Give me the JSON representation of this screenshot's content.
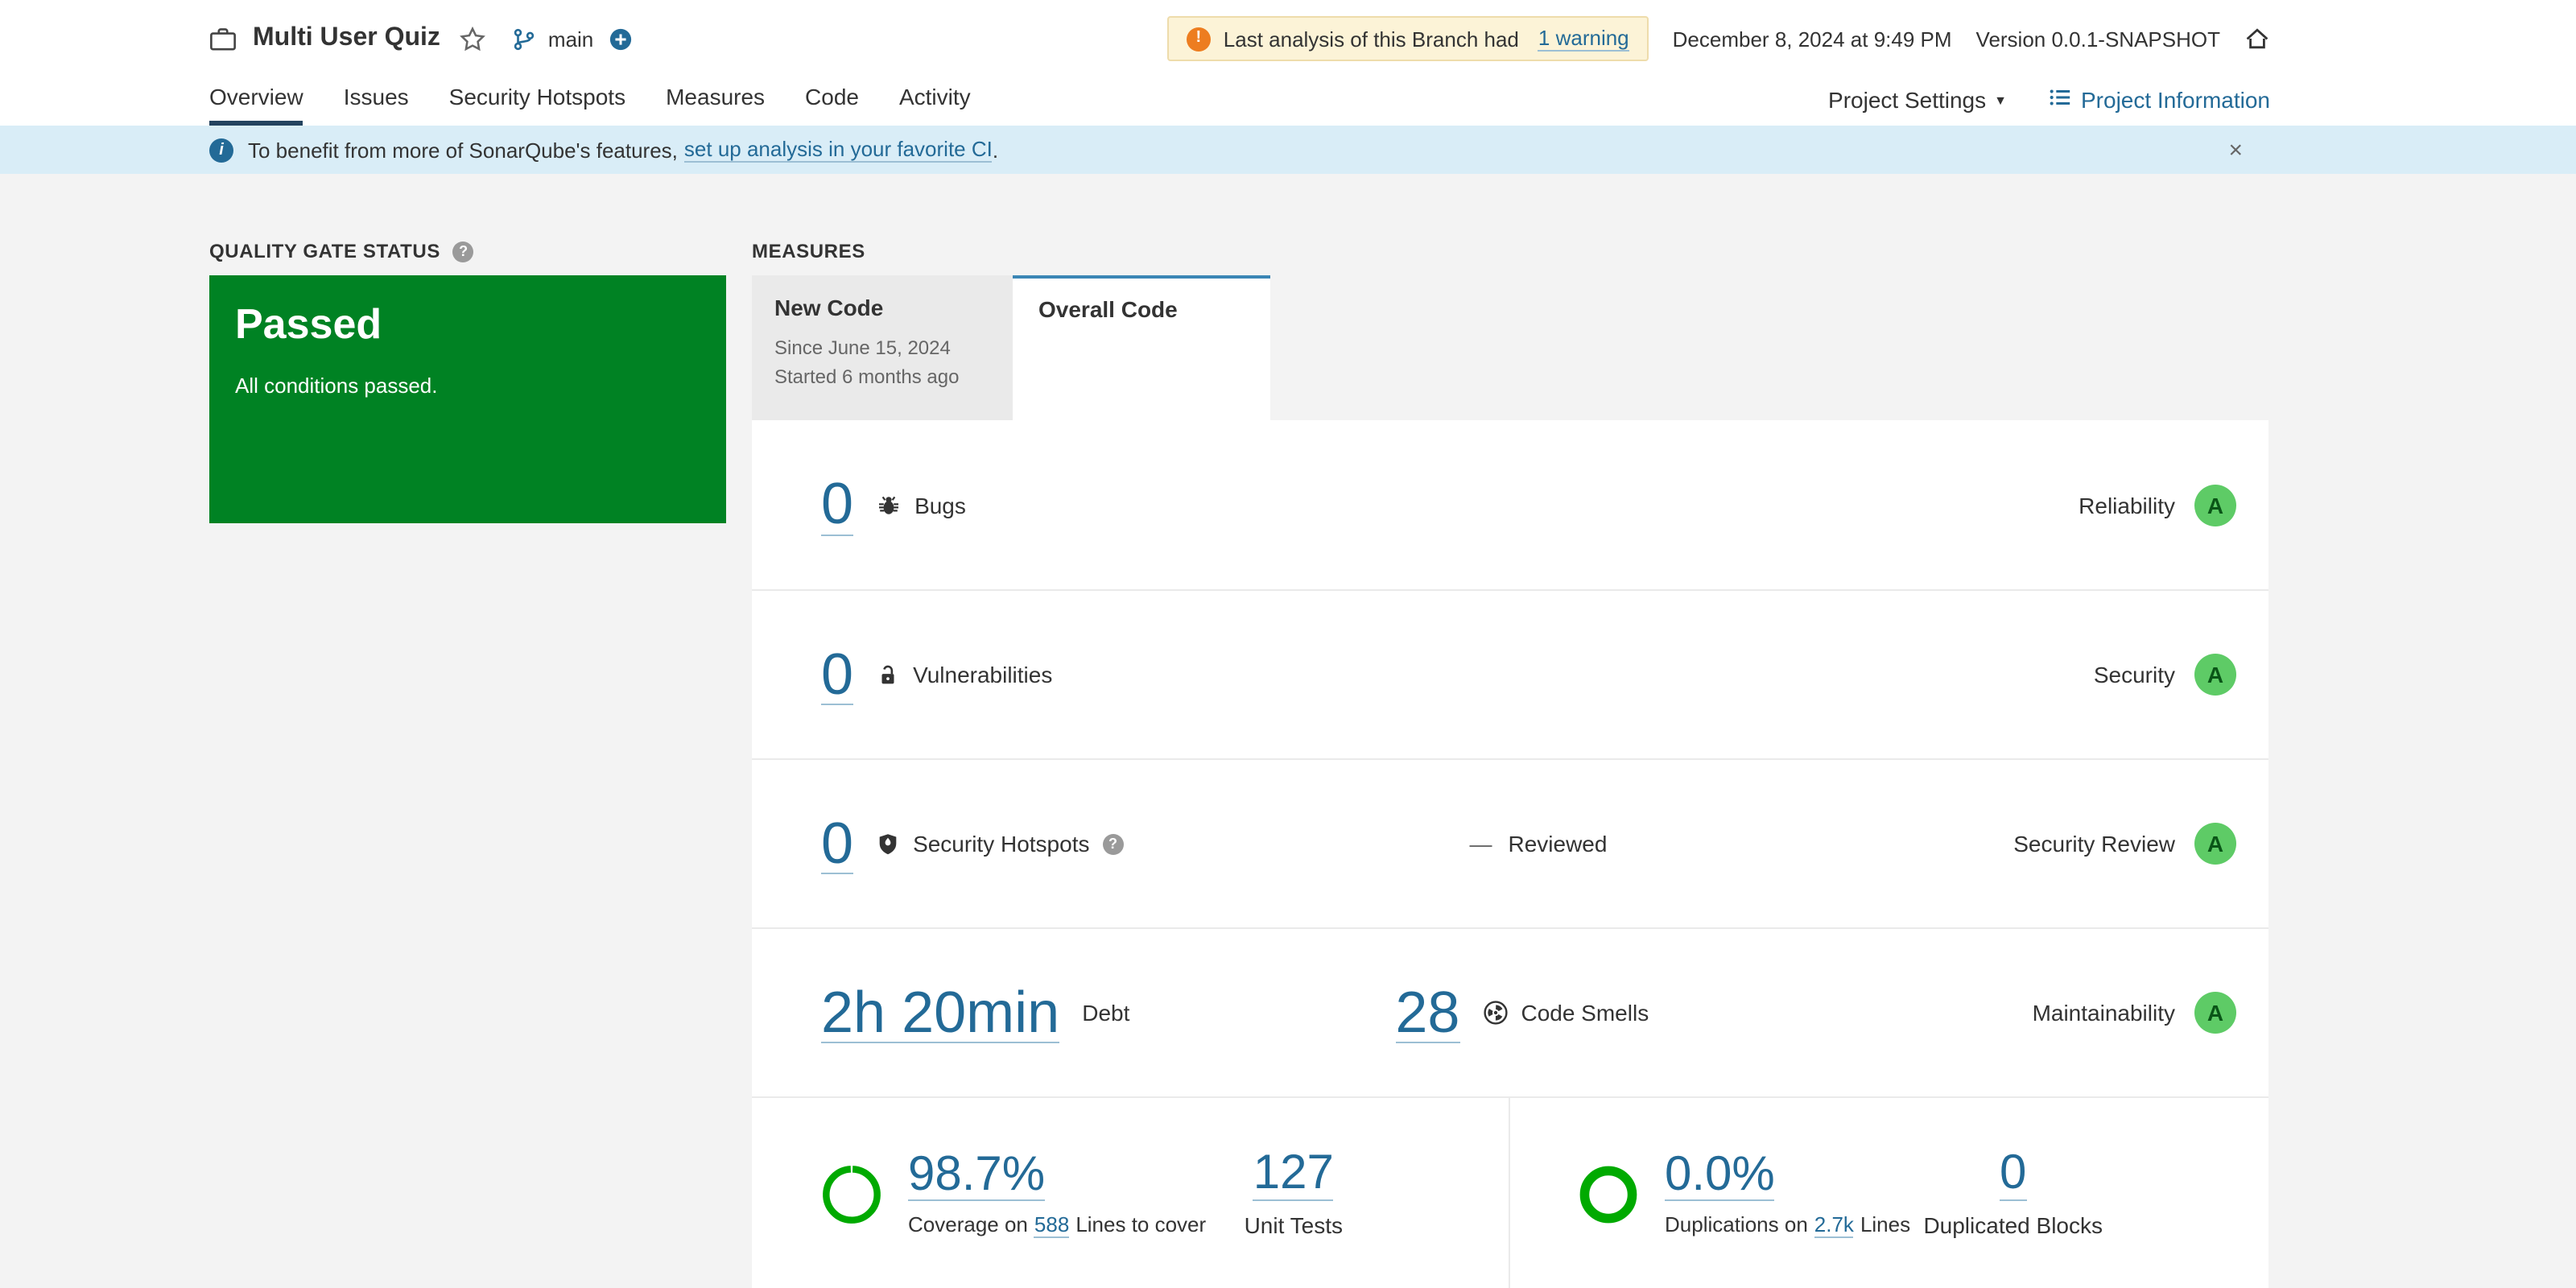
{
  "header": {
    "project_name": "Multi User Quiz",
    "branch": "main",
    "warning_text": "Last analysis of this Branch had",
    "warning_link": "1 warning",
    "analysis_date": "December 8, 2024 at 9:49 PM",
    "version_label": "Version 0.0.1-SNAPSHOT"
  },
  "nav": {
    "tabs": [
      {
        "label": "Overview",
        "active": true
      },
      {
        "label": "Issues",
        "active": false
      },
      {
        "label": "Security Hotspots",
        "active": false
      },
      {
        "label": "Measures",
        "active": false
      },
      {
        "label": "Code",
        "active": false
      },
      {
        "label": "Activity",
        "active": false
      }
    ],
    "project_settings_label": "Project Settings",
    "project_information_label": "Project Information"
  },
  "banner": {
    "message_prefix": "To benefit from more of SonarQube's features,",
    "link_text": "set up analysis in your favorite CI",
    "message_suffix": "."
  },
  "icons": {
    "warning_mark": "!",
    "info_mark": "i",
    "help_mark": "?",
    "close_mark": "×",
    "caret_down": "▼"
  },
  "quality_gate": {
    "heading": "QUALITY GATE STATUS",
    "status": "Passed",
    "detail": "All conditions passed."
  },
  "measures": {
    "heading": "MEASURES",
    "new_code_tab": {
      "label": "New Code",
      "since": "Since June 15, 2024",
      "started": "Started 6 months ago"
    },
    "overall_code_tab": {
      "label": "Overall Code"
    },
    "rows": {
      "bugs": {
        "value": "0",
        "label": "Bugs",
        "domain": "Reliability",
        "rating": "A"
      },
      "vulnerabilities": {
        "value": "0",
        "label": "Vulnerabilities",
        "domain": "Security",
        "rating": "A"
      },
      "hotspots": {
        "value": "0",
        "label": "Security Hotspots",
        "reviewed_value": "—",
        "reviewed_label": "Reviewed",
        "domain": "Security Review",
        "rating": "A"
      },
      "maintainability": {
        "debt_value": "2h 20min",
        "debt_label": "Debt",
        "smells_value": "28",
        "smells_label": "Code Smells",
        "domain": "Maintainability",
        "rating": "A"
      }
    },
    "coverage": {
      "value": "98.7%",
      "caption_prefix": "Coverage on",
      "lines_link": "588",
      "caption_suffix": "Lines to cover",
      "tests_value": "127",
      "tests_label": "Unit Tests"
    },
    "duplications": {
      "value": "0.0%",
      "caption_prefix": "Duplications on",
      "lines_link": "2.7k",
      "caption_suffix": "Lines",
      "blocks_value": "0",
      "blocks_label": "Duplicated Blocks"
    }
  },
  "colors": {
    "link_blue": "#236a97",
    "passed_green": "#008223",
    "rating_a_bg": "#5ecb66",
    "warning_orange": "#ed7d20",
    "banner_blue": "#d9edf7",
    "gauge_green": "#00aa00"
  }
}
